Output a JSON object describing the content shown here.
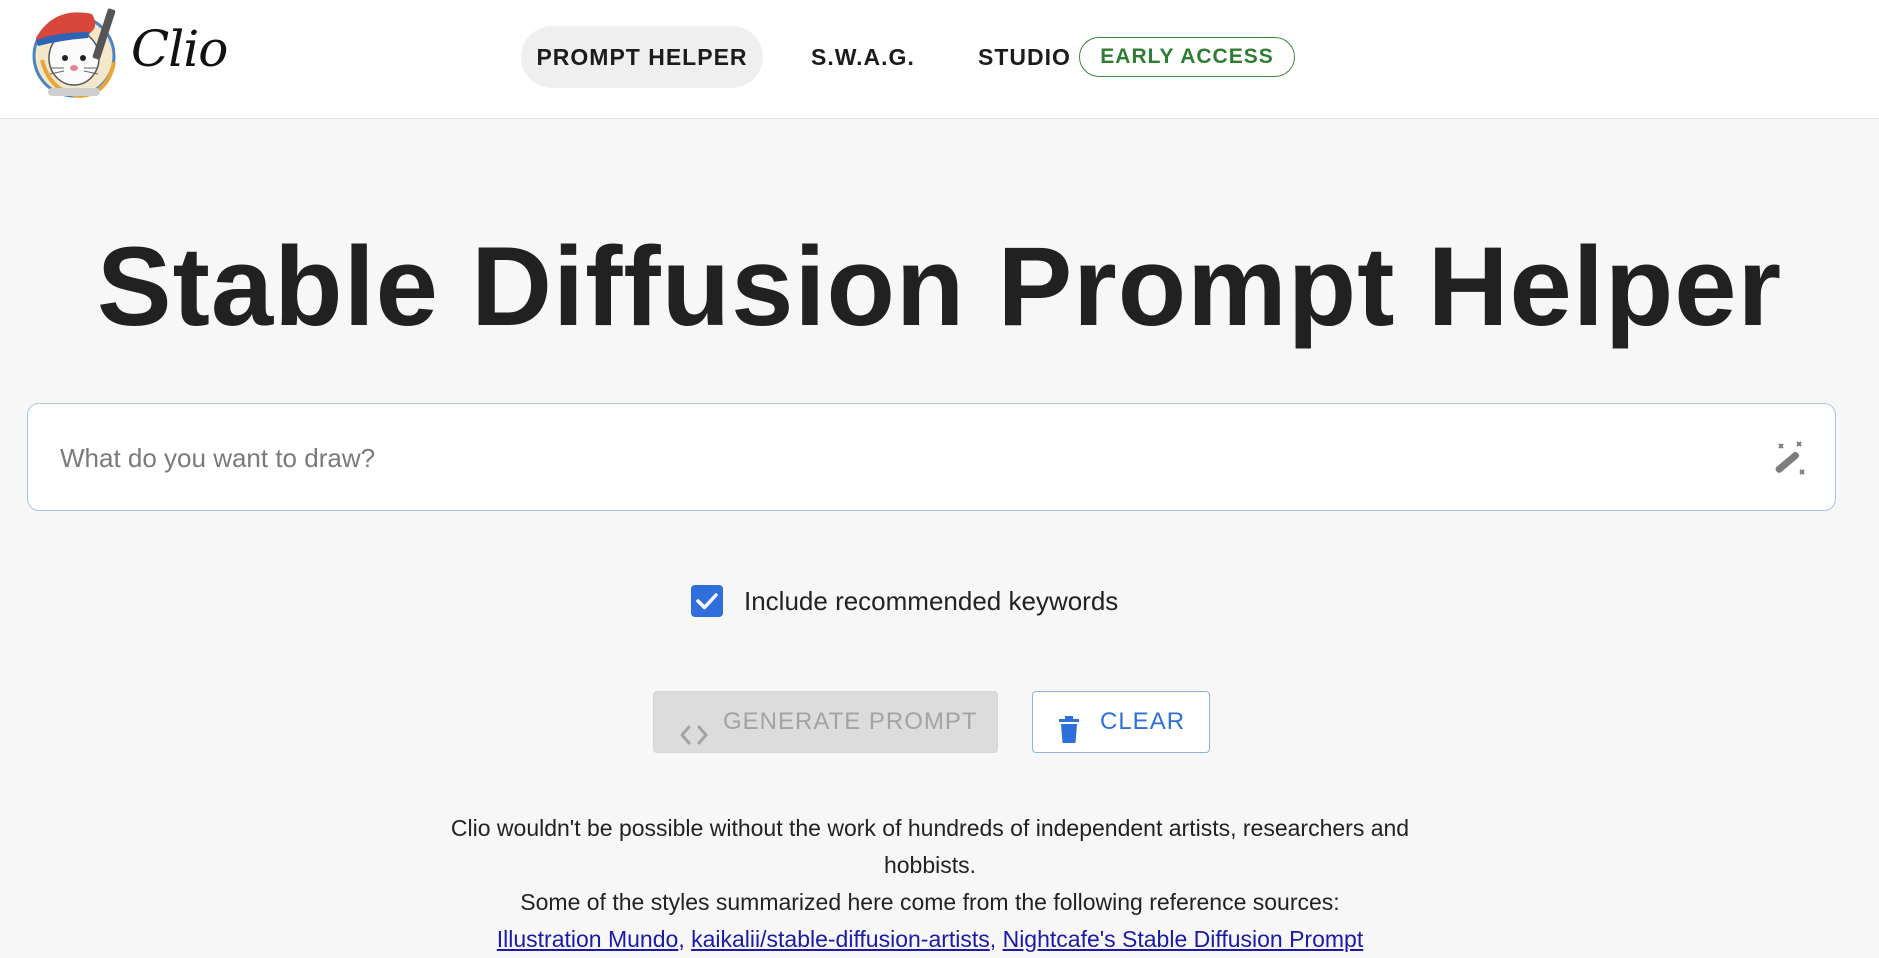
{
  "brand": {
    "name": "Clio"
  },
  "nav": {
    "items": [
      {
        "label": "PROMPT HELPER",
        "active": true
      },
      {
        "label": "S.W.A.G."
      },
      {
        "label": "STUDIO"
      }
    ],
    "badge": "EARLY ACCESS"
  },
  "main": {
    "title": "Stable Diffusion Prompt Helper",
    "search": {
      "placeholder": "What do you want to draw?",
      "value": ""
    },
    "checkbox": {
      "label": "Include recommended keywords",
      "checked": true
    },
    "buttons": {
      "generate": {
        "label": "GENERATE PROMPT",
        "icon": "code-icon",
        "disabled": true
      },
      "clear": {
        "label": "CLEAR",
        "icon": "trash-icon"
      }
    },
    "credits": {
      "line1": "Clio wouldn't be possible without the work of hundreds of independent artists, researchers and hobbists.",
      "line2": "Some of the styles summarized here come from the following reference sources:",
      "links": [
        "Illustration Mundo",
        "kaikalii/stable-diffusion-artists",
        "Nightcafe's Stable Diffusion Prompt"
      ],
      "separator": ","
    }
  },
  "colors": {
    "accent": "#2f6fdc",
    "badge": "#2e7d32",
    "background": "#f7f7f7",
    "link": "#1a1aa6"
  }
}
